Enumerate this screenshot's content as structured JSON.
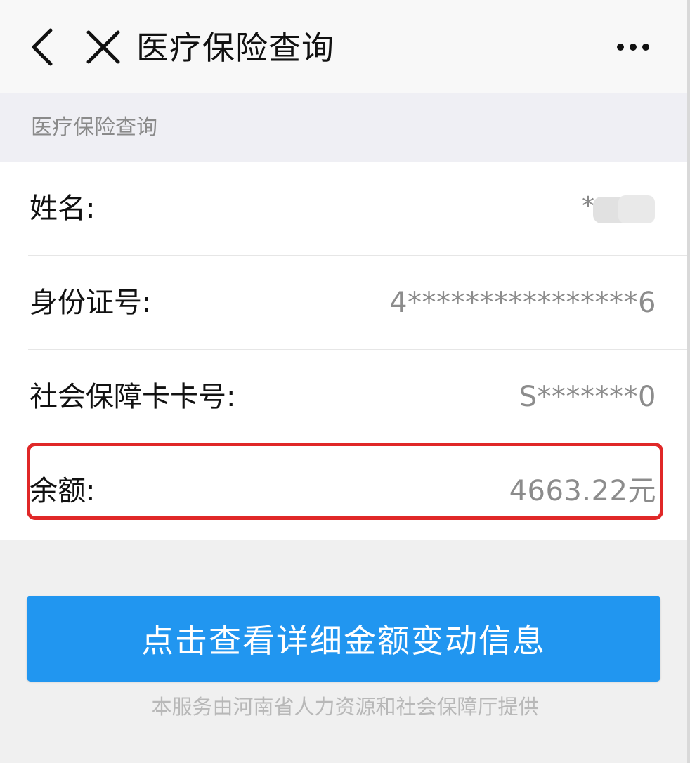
{
  "topbar": {
    "title": "医疗保险查询",
    "back_icon": "chevron-left-icon",
    "close_icon": "close-icon",
    "more_icon": "more-horizontal-icon"
  },
  "section": {
    "title": "医疗保险查询"
  },
  "fields": {
    "name": {
      "label": "姓名:",
      "value_visible": "*"
    },
    "id_number": {
      "label": "身份证号:",
      "value": "4****************6"
    },
    "ss_card": {
      "label": "社会保障卡卡号:",
      "value": "S*******0"
    },
    "balance": {
      "label": "余额:",
      "value": "4663.22元"
    }
  },
  "action": {
    "button_label": "点击查看详细金额变动信息"
  },
  "footer": {
    "provider_text": "本服务由河南省人力资源和社会保障厅提供"
  },
  "colors": {
    "primary_blue": "#2196f0",
    "highlight_red": "#e02828",
    "page_bg": "#f0f0f0",
    "card_bg": "#ffffff"
  }
}
